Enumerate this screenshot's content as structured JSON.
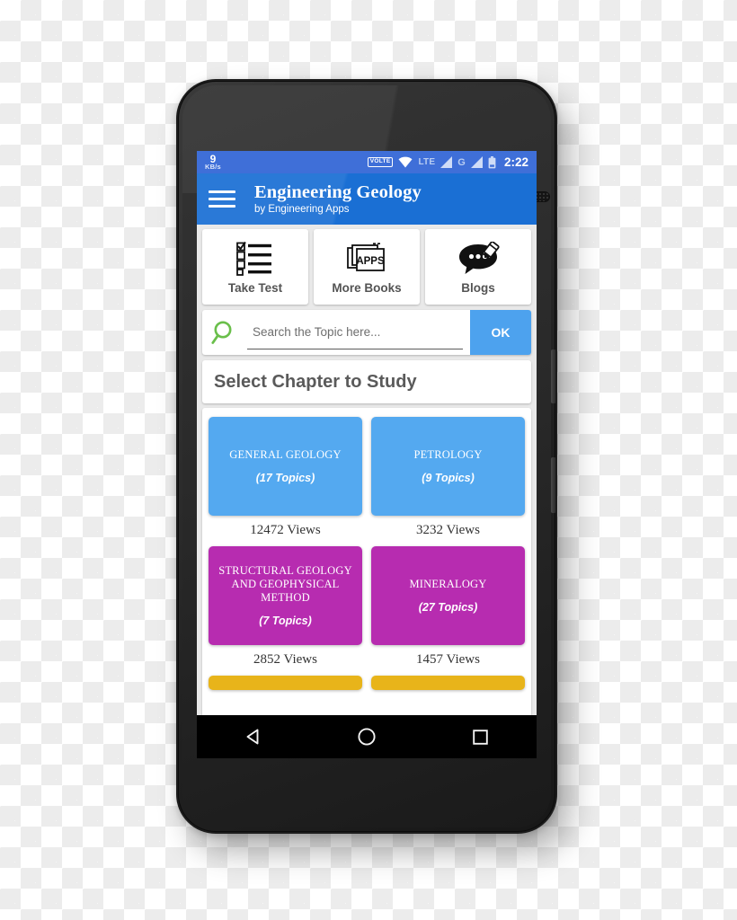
{
  "device": {
    "type": "android-smartphone",
    "frame_color": "#222222"
  },
  "status_bar": {
    "network_speed_value": "9",
    "network_speed_unit": "KB/s",
    "volte_label": "VOLTE",
    "lte_label": "LTE",
    "g_label": "G",
    "clock": "2:22",
    "background_color": "#3f6fd8",
    "icons": [
      "volte-badge",
      "wifi-icon",
      "lte-signal-icon",
      "g-signal-icon",
      "battery-icon"
    ]
  },
  "app_bar": {
    "menu_icon": "hamburger-menu-icon",
    "title": "Engineering Geology",
    "subtitle": "by Engineering Apps",
    "background_color": "#1a6fd4"
  },
  "quick_actions": [
    {
      "label": "Take Test",
      "icon": "checklist-icon"
    },
    {
      "label": "More Books",
      "icon": "apps-stack-icon"
    },
    {
      "label": "Blogs",
      "icon": "speech-bubble-pen-icon"
    }
  ],
  "search": {
    "icon": "search-icon",
    "icon_color": "#6abf4b",
    "placeholder": "Search the Topic here...",
    "value": "",
    "button_label": "OK",
    "button_color": "#4da2ee"
  },
  "section": {
    "title": "Select Chapter to Study"
  },
  "chapters": [
    {
      "name": "GENERAL GEOLOGY",
      "topics": "(17 Topics)",
      "views": "12472 Views",
      "color": "#54a9f0"
    },
    {
      "name": "PETROLOGY",
      "topics": "(9 Topics)",
      "views": "3232 Views",
      "color": "#54a9f0"
    },
    {
      "name": "STRUCTURAL GEOLOGY AND GEOPHYSICAL METHOD",
      "topics": "(7 Topics)",
      "views": "2852 Views",
      "color": "#b72cb0"
    },
    {
      "name": "MINERALOGY",
      "topics": "(27 Topics)",
      "views": "1457 Views",
      "color": "#b72cb0"
    },
    {
      "name": "",
      "topics": "",
      "views": "",
      "color": "#e8b41a"
    },
    {
      "name": "",
      "topics": "",
      "views": "",
      "color": "#e8b41a"
    }
  ],
  "nav_bar": {
    "back_label": "Back",
    "home_label": "Home",
    "recents_label": "Recents",
    "background_color": "#000000"
  }
}
